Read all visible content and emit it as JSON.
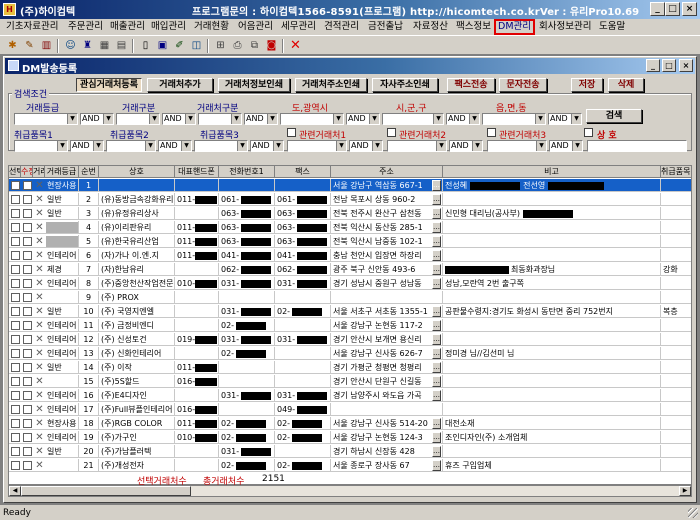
{
  "window": {
    "title": "(주)하이컴텍",
    "center_title": "프로그램문의 : 하이컴텍1566-8591(프로그램)  http://hicomtech.co.kr",
    "version": "Ver : 유리Pro10.69",
    "min": "_",
    "max": "□",
    "close": "×"
  },
  "menu": [
    {
      "label": "기초자료관리",
      "highlight": false
    },
    {
      "label": "주문관리",
      "highlight": false
    },
    {
      "label": "매출관리",
      "highlight": false
    },
    {
      "label": "매입관리",
      "highlight": false
    },
    {
      "label": "거래현황",
      "highlight": false
    },
    {
      "label": "어음관리",
      "highlight": false
    },
    {
      "label": "세무관리",
      "highlight": false
    },
    {
      "label": "견적관리",
      "highlight": false
    },
    {
      "label": "금전출납",
      "highlight": false
    },
    {
      "label": "자료정산",
      "highlight": false
    },
    {
      "label": "팩스정보",
      "highlight": false
    },
    {
      "label": "DM관리",
      "highlight": true
    },
    {
      "label": "회사정보관리",
      "highlight": false
    },
    {
      "label": "도움말",
      "highlight": false
    }
  ],
  "child": {
    "title": "DM발송등록",
    "min": "_",
    "max": "□",
    "close": "×"
  },
  "action_buttons": [
    {
      "label": "관심거래처등록",
      "pressed": true
    },
    {
      "label": "거래처추가",
      "pressed": false
    },
    {
      "label": "거래처정보인쇄",
      "pressed": false
    },
    {
      "label": "거래처주소인쇄",
      "pressed": false
    },
    {
      "label": "자사주소인쇄",
      "pressed": false
    },
    {
      "label": "팩스전송",
      "pressed": false
    },
    {
      "label": "문자전송",
      "pressed": false
    },
    {
      "label": "저장",
      "pressed": false
    },
    {
      "label": "삭제",
      "pressed": false
    }
  ],
  "search": {
    "legend": "검색조건",
    "labels": {
      "grade": "거래등급",
      "type": "거래구분",
      "partner_type": "거래처구분",
      "province": "도,광역시",
      "city": "시,군,구",
      "town": "읍,면,동",
      "item1": "취급품목1",
      "item2": "취급품목2",
      "item3": "취급품목3",
      "related1": "관련거래처1",
      "related2": "관련거래처2",
      "related3": "관련거래처3",
      "sangho": "상     호"
    },
    "and_label": "AND",
    "search_button": "검색"
  },
  "grid": {
    "headers": [
      "선택",
      "수정",
      "거래",
      "거래등급",
      "순번",
      "상호",
      "대표핸드폰",
      "전화번호1",
      "팩스",
      "주소",
      "비고",
      "취급품목1"
    ],
    "rows": [
      {
        "grade": "현장사용",
        "no": "1",
        "name": "",
        "mobile": "",
        "tel_pre": "",
        "fax_pre": "",
        "address": "서울 강남구 역삼동 667-1",
        "note": "전성혜",
        "note2": "전선영",
        "item": "",
        "sel": true,
        "gray": false
      },
      {
        "grade": "일반",
        "no": "2",
        "name": "(유)동방금속강화유리",
        "mobile": "011-",
        "tel_pre": "061-",
        "fax_pre": "061-",
        "address": "전남 목포시 상동 960-2",
        "note": "",
        "note2": "",
        "item": "",
        "sel": false,
        "gray": false
      },
      {
        "grade": "일반",
        "no": "3",
        "name": "(유)유정유리상사",
        "mobile": "",
        "tel_pre": "063-",
        "fax_pre": "063-",
        "address": "전북 전주시 완산구 삼천동",
        "note": "신민형 대리님(공사부)",
        "note2": "",
        "item": "",
        "sel": false,
        "gray": false
      },
      {
        "grade": "",
        "no": "4",
        "name": "(유)이리판유리",
        "mobile": "011-",
        "tel_pre": "063-",
        "fax_pre": "063-",
        "address": "전북 익산시 동산동 285-1",
        "note": "",
        "note2": "",
        "item": "",
        "sel": false,
        "gray": true
      },
      {
        "grade": "",
        "no": "5",
        "name": "(유)한국유리산업",
        "mobile": "011-",
        "tel_pre": "063-",
        "fax_pre": "063-",
        "address": "전북 익산시 남중동 102-1",
        "note": "",
        "note2": "",
        "item": "",
        "sel": false,
        "gray": true
      },
      {
        "grade": "인테리어",
        "no": "6",
        "name": "(자)가나 이.엔.지",
        "mobile": "011-",
        "tel_pre": "041-",
        "fax_pre": "041-",
        "address": "충남 천안시 입장면 하장리",
        "note": "",
        "note2": "",
        "item": "",
        "sel": false,
        "gray": false
      },
      {
        "grade": "제경",
        "no": "7",
        "name": "(자)한남유리",
        "mobile": "",
        "tel_pre": "062-",
        "fax_pre": "062-",
        "address": "광주 북구 신안동 493-6",
        "note": "",
        "note2": "최동화과장님",
        "item": "강화",
        "sel": false,
        "gray": false
      },
      {
        "grade": "인테리어",
        "no": "8",
        "name": "(주)중앙천산작업전문",
        "mobile": "010-",
        "tel_pre": "031-",
        "fax_pre": "031-",
        "address": "경기 성남시 중원구 성남동",
        "note": "성남,모란역 2번 출구쪽",
        "note2": "",
        "item": "",
        "sel": false,
        "gray": false
      },
      {
        "grade": "",
        "no": "9",
        "name": "(주) PROX",
        "mobile": "",
        "tel_pre": "",
        "fax_pre": "",
        "address": "",
        "note": "",
        "note2": "",
        "item": "",
        "sel": false,
        "gray": false
      },
      {
        "grade": "일반",
        "no": "10",
        "name": "(주) 국영지엔엘",
        "mobile": "",
        "tel_pre": "031-",
        "fax_pre": "02-",
        "address": "서울 서초구 서초동 1355-1",
        "note": "공판물수령지:경기도 화성시 동탄면 중리 752번지",
        "note2": "",
        "item": "복층",
        "sel": false,
        "gray": false
      },
      {
        "grade": "인테리어",
        "no": "11",
        "name": "(주) 금정비엔디",
        "mobile": "",
        "tel_pre": "02-",
        "fax_pre": "",
        "address": "서울 강남구 논현동 117-2",
        "note": "",
        "note2": "",
        "item": "",
        "sel": false,
        "gray": false
      },
      {
        "grade": "인테리어",
        "no": "12",
        "name": "(주) 신성토건",
        "mobile": "019-",
        "tel_pre": "031-",
        "fax_pre": "031-",
        "address": "경기 안산시 보개면 용신리",
        "note": "",
        "note2": "",
        "item": "",
        "sel": false,
        "gray": false
      },
      {
        "grade": "인테리어",
        "no": "13",
        "name": "(주) 신화인테리어",
        "mobile": "",
        "tel_pre": "02-",
        "fax_pre": "",
        "address": "서울 강남구 신사동 626-7",
        "note": "정미경 님//김선미 님",
        "note2": "",
        "item": "",
        "sel": false,
        "gray": false
      },
      {
        "grade": "일반",
        "no": "14",
        "name": "(주) 이작",
        "mobile": "011-",
        "tel_pre": "",
        "fax_pre": "",
        "address": "경기 가평군 청평면 청평리",
        "note": "",
        "note2": "",
        "item": "",
        "sel": false,
        "gray": false
      },
      {
        "grade": "",
        "no": "15",
        "name": "(주)5S할드",
        "mobile": "016-",
        "tel_pre": "",
        "fax_pre": "",
        "address": "경기 안산시 단원구 신길동",
        "note": "",
        "note2": "",
        "item": "",
        "sel": false,
        "gray": false
      },
      {
        "grade": "인테리어",
        "no": "16",
        "name": "(주)E4디자인",
        "mobile": "",
        "tel_pre": "031-",
        "fax_pre": "031-",
        "address": "경기 남양주시 와도읍 가곡",
        "note": "",
        "note2": "",
        "item": "",
        "sel": false,
        "gray": false
      },
      {
        "grade": "인테리어",
        "no": "17",
        "name": "(주)Full뷰플인테리어",
        "mobile": "016-",
        "tel_pre": "",
        "fax_pre": "049-",
        "address": "",
        "note": "",
        "note2": "",
        "item": "",
        "sel": false,
        "gray": false
      },
      {
        "grade": "현장사용",
        "no": "18",
        "name": "(주)RGB COLOR",
        "mobile": "011-",
        "tel_pre": "02-",
        "fax_pre": "02-",
        "address": "서울 강남구 신사동 514-20",
        "note": "대전소재",
        "note2": "",
        "item": "",
        "sel": false,
        "gray": false
      },
      {
        "grade": "인테리어",
        "no": "19",
        "name": "(주)가구인",
        "mobile": "010-",
        "tel_pre": "02-",
        "fax_pre": "02-",
        "address": "서울 강남구 논현동 124-3",
        "note": "조인디자인(주) 소개업체",
        "note2": "",
        "item": "",
        "sel": false,
        "gray": false
      },
      {
        "grade": "일반",
        "no": "20",
        "name": "(주)가남플러텍",
        "mobile": "",
        "tel_pre": "031-",
        "fax_pre": "",
        "address": "경기 하남시 신장동 428",
        "note": "",
        "note2": "",
        "item": "",
        "sel": false,
        "gray": false
      },
      {
        "grade": "",
        "no": "21",
        "name": "(주)개성전자",
        "mobile": "",
        "tel_pre": "02-",
        "fax_pre": "02-",
        "address": "서울 종로구 장사동 67",
        "note": "휴즈 구입업체",
        "note2": "",
        "item": "",
        "sel": false,
        "gray": false
      }
    ]
  },
  "footer": {
    "selected_label": "선택거래처수",
    "total_label": "총거래처수",
    "total_value": "2151"
  },
  "status": {
    "text": "Ready"
  },
  "colors": {
    "accent": "#0a246a",
    "selection": "#1560c8",
    "highlight_red": "#e00000"
  }
}
